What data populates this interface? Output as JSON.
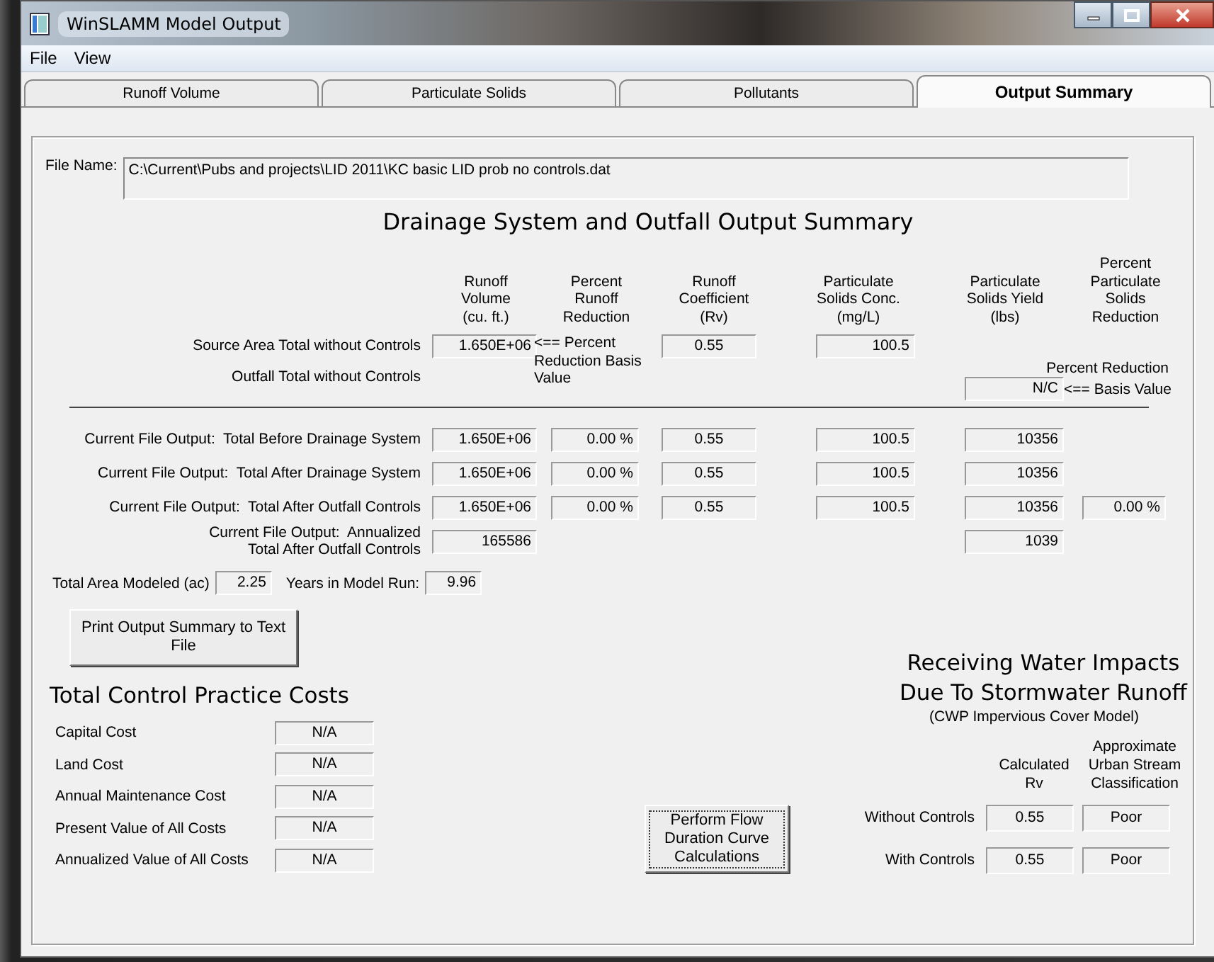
{
  "window": {
    "title": "WinSLAMM Model Output"
  },
  "menu": [
    "File",
    "View"
  ],
  "tabs": [
    {
      "label": "Runoff Volume",
      "selected": false
    },
    {
      "label": "Particulate Solids",
      "selected": false
    },
    {
      "label": "Pollutants",
      "selected": false
    },
    {
      "label": "Output Summary",
      "selected": true
    }
  ],
  "file_name": {
    "label": "File Name:",
    "value": "C:\\Current\\Pubs and projects\\LID 2011\\KC basic LID prob no controls.dat"
  },
  "summary": {
    "title": "Drainage System and Outfall Output Summary",
    "columns": {
      "runoff_volume": "Runoff\nVolume\n(cu. ft.)",
      "percent_runoff_reduction": "Percent\nRunoff\nReduction",
      "runoff_coefficient": "Runoff\nCoefficient\n(Rv)",
      "solids_conc": "Particulate\nSolids Conc.\n(mg/L)",
      "solids_yield": "Particulate\nSolids Yield\n(lbs)",
      "percent_solids_reduction": "Percent\nParticulate\nSolids\nReduction"
    },
    "source_row": {
      "label": "Source Area Total without Controls",
      "values": {
        "runoff_volume": "1.650E+06",
        "runoff_coefficient": "0.55",
        "solids_conc": "100.5"
      },
      "note": "<== Percent Reduction Basis Value"
    },
    "outfall_row": {
      "label": "Outfall Total without Controls",
      "caption": "Percent Reduction",
      "value": "N/C",
      "note": "<== Basis Value"
    },
    "rows": [
      {
        "label": "Current File Output:  Total Before Drainage System",
        "values": {
          "runoff_volume": "1.650E+06",
          "percent_runoff_reduction": "0.00 %",
          "runoff_coefficient": "0.55",
          "solids_conc": "100.5",
          "solids_yield": "10356"
        }
      },
      {
        "label": "Current File Output:  Total After Drainage System",
        "values": {
          "runoff_volume": "1.650E+06",
          "percent_runoff_reduction": "0.00 %",
          "runoff_coefficient": "0.55",
          "solids_conc": "100.5",
          "solids_yield": "10356"
        }
      },
      {
        "label": "Current File Output:  Total After Outfall Controls",
        "values": {
          "runoff_volume": "1.650E+06",
          "percent_runoff_reduction": "0.00 %",
          "runoff_coefficient": "0.55",
          "solids_conc": "100.5",
          "solids_yield": "10356",
          "percent_solids_reduction": "0.00 %"
        }
      },
      {
        "label": "Current File Output:  Annualized\nTotal After Outfall Controls",
        "values": {
          "runoff_volume": "165586",
          "solids_yield": "1039"
        }
      }
    ],
    "area": {
      "label": "Total Area Modeled (ac)",
      "value": "2.25"
    },
    "years": {
      "label": "Years in Model Run:",
      "value": "9.96"
    }
  },
  "print_button": "Print Output Summary to Text\nFile",
  "costs": {
    "title": "Total Control Practice Costs",
    "rows": [
      {
        "label": "Capital Cost",
        "value": "N/A"
      },
      {
        "label": "Land Cost",
        "value": "N/A"
      },
      {
        "label": "Annual Maintenance Cost",
        "value": "N/A"
      },
      {
        "label": "Present Value of All Costs",
        "value": "N/A"
      },
      {
        "label": "Annualized Value of All Costs",
        "value": "N/A"
      }
    ]
  },
  "flow_button": "Perform Flow\nDuration Curve\nCalculations",
  "receiving": {
    "title": "Receiving Water Impacts\nDue To Stormwater Runoff",
    "subtitle": "(CWP Impervious Cover Model)",
    "columns": [
      "Calculated\nRv",
      "Approximate\nUrban Stream\nClassification"
    ],
    "rows": [
      {
        "label": "Without Controls",
        "values": [
          "0.55",
          "Poor"
        ]
      },
      {
        "label": "With Controls",
        "values": [
          "0.55",
          "Poor"
        ]
      }
    ]
  }
}
